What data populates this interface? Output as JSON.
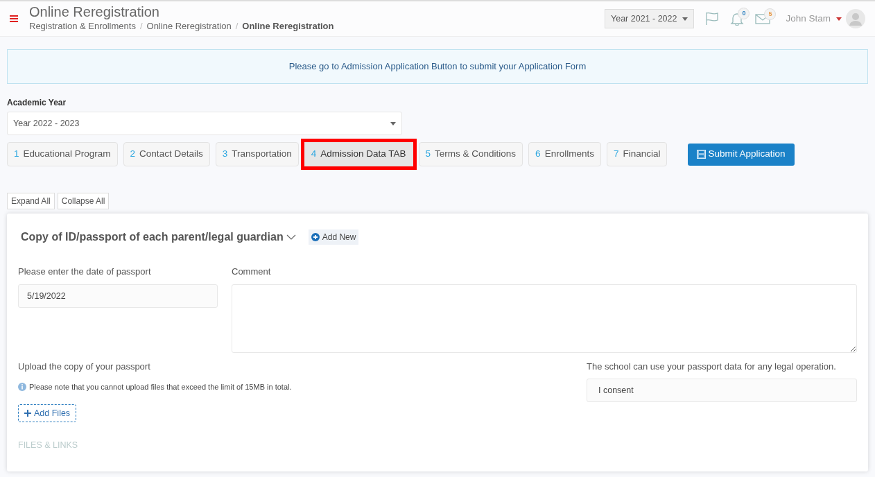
{
  "header": {
    "title": "Online Reregistration",
    "breadcrumbs": [
      {
        "label": "Registration & Enrollments",
        "current": false
      },
      {
        "label": "Online Reregistration",
        "current": false
      },
      {
        "label": "Online Reregistration",
        "current": true
      }
    ],
    "breadcrumb_separators": [
      "/",
      "/"
    ],
    "year_select": "Year 2021 - 2022",
    "notifications": "0",
    "messages": "5",
    "user": "John Stam"
  },
  "alert": "Please go to Admission Application Button to submit your Application Form",
  "academic_year": {
    "label": "Academic Year",
    "value": "Year 2022 - 2023"
  },
  "tabs": [
    {
      "number": "1",
      "label": "Educational Program",
      "selected": false,
      "highlighted": false
    },
    {
      "number": "2",
      "label": "Contact Details",
      "selected": false,
      "highlighted": false
    },
    {
      "number": "3",
      "label": "Transportation",
      "selected": false,
      "highlighted": false
    },
    {
      "number": "4",
      "label": "Admission Data TAB",
      "selected": true,
      "highlighted": true
    },
    {
      "number": "5",
      "label": "Terms & Conditions",
      "selected": false,
      "highlighted": false
    },
    {
      "number": "6",
      "label": "Enrollments",
      "selected": false,
      "highlighted": false
    },
    {
      "number": "7",
      "label": "Financial",
      "selected": false,
      "highlighted": false
    }
  ],
  "submit_button": "Submit Application",
  "expand_all": "Expand All",
  "collapse_all": "Collapse All",
  "section": {
    "title": "Copy of ID/passport of each parent/legal guardian",
    "expanded": true,
    "add_new": "Add New",
    "date_label": "Please enter the date of passport",
    "date_value": "5/19/2022",
    "comment_label": "Comment",
    "upload_label": "Upload the copy of your passport",
    "upload_note": "Please note that you cannot upload files that exceed the limit of 15MB in total.",
    "add_files": "Add Files",
    "files_links": "FILES & LINKS",
    "consent_label": "The school can use your passport data for any legal operation.",
    "consent_value": "I consent"
  }
}
